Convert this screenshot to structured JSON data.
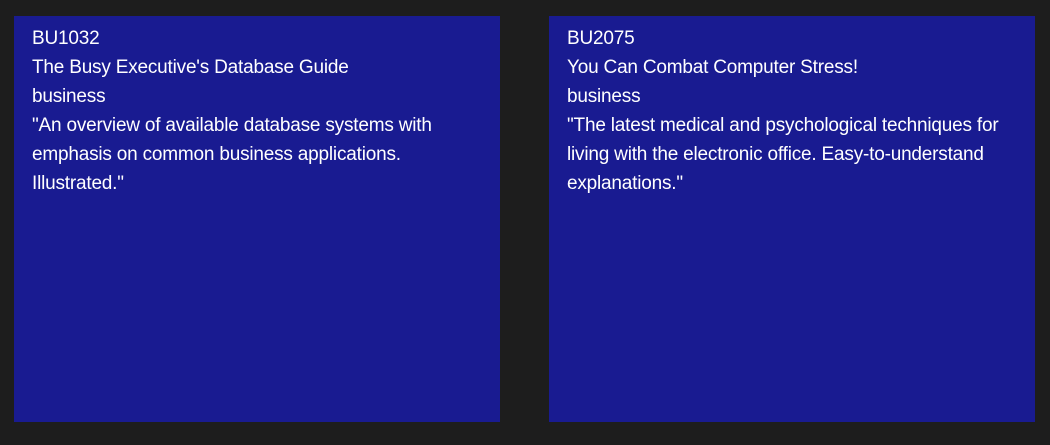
{
  "tiles": [
    {
      "id": "BU1032",
      "title": "The Busy Executive's Database Guide",
      "type": "business",
      "notes": "\"An overview of available database systems with emphasis on common business applications. Illustrated.\""
    },
    {
      "id": "BU2075",
      "title": "You Can Combat Computer Stress!",
      "type": "business",
      "notes": "\"The latest medical and psychological techniques for living with the electronic office. Easy-to-understand explanations.\""
    }
  ],
  "colors": {
    "background": "#1d1d1d",
    "tile": "#191b91",
    "text": "#ffffff"
  }
}
